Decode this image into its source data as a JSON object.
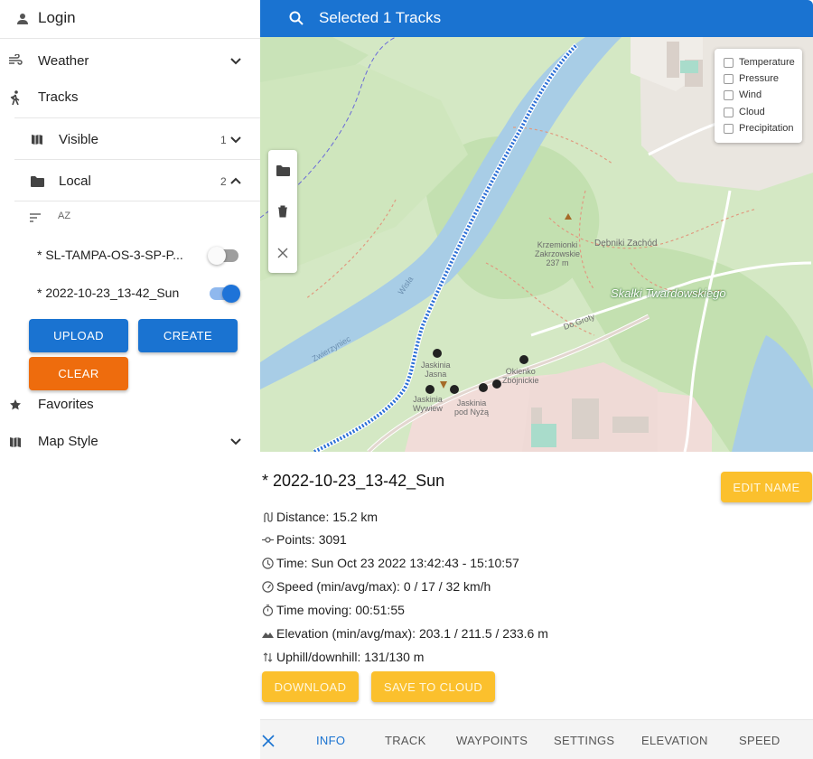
{
  "sidebar": {
    "login": "Login",
    "weather": "Weather",
    "tracks": "Tracks",
    "visible": {
      "label": "Visible",
      "count": "1"
    },
    "local": {
      "label": "Local",
      "count": "2"
    },
    "sort_label": "AZ",
    "track_items": [
      {
        "name": "* SL-TAMPA-OS-3-SP-P...",
        "enabled": false
      },
      {
        "name": "* 2022-10-23_13-42_Sun",
        "enabled": true
      }
    ],
    "buttons": {
      "upload": "UPLOAD",
      "create": "CREATE",
      "clear": "CLEAR"
    },
    "favorites": "Favorites",
    "map_style": "Map Style"
  },
  "topbar": {
    "title": "Selected 1 Tracks"
  },
  "map": {
    "weather_layers": [
      "Temperature",
      "Pressure",
      "Wind",
      "Cloud",
      "Precipitation"
    ],
    "labels": {
      "krzemionki": "Krzemionki",
      "zakrzowskie": "Zakrzowskie",
      "elev": "237 m",
      "debniki": "Dębniki Zachód",
      "skalki": "Skałki Twardowskiego",
      "jaskinia_jasna_1": "Jaskinia",
      "jaskinia_jasna_2": "Jasna",
      "okienko_1": "Okienko",
      "okienko_2": "Zbójnickie",
      "wywiew_1": "Jaskinia",
      "wywiew_2": "Wywiew",
      "pod_nyza_1": "Jaskinia",
      "pod_nyza_2": "pod Nyżą",
      "do_groty": "Do Groty",
      "wisla": "Wisła",
      "zwierzyniec": "Zwierzyniec"
    }
  },
  "track": {
    "name": "* 2022-10-23_13-42_Sun",
    "edit_name": "EDIT NAME",
    "distance": "Distance: 15.2 km",
    "points": "Points: 3091",
    "time": "Time: Sun Oct 23 2022 13:42:43 - 15:10:57",
    "speed": "Speed (min/avg/max): 0 / 17 / 32 km/h",
    "time_moving": "Time moving: 00:51:55",
    "elevation": "Elevation (min/avg/max): 203.1 / 211.5 / 233.6 m",
    "uphill": "Uphill/downhill: 131/130 m",
    "download": "DOWNLOAD",
    "save_cloud": "SAVE TO CLOUD"
  },
  "tabs": [
    "INFO",
    "TRACK",
    "WAYPOINTS",
    "SETTINGS",
    "ELEVATION",
    "SPEED"
  ],
  "colors": {
    "primary": "#1a73d1",
    "accent_orange": "#ee6c0d",
    "accent_yellow": "#fbc02d"
  }
}
